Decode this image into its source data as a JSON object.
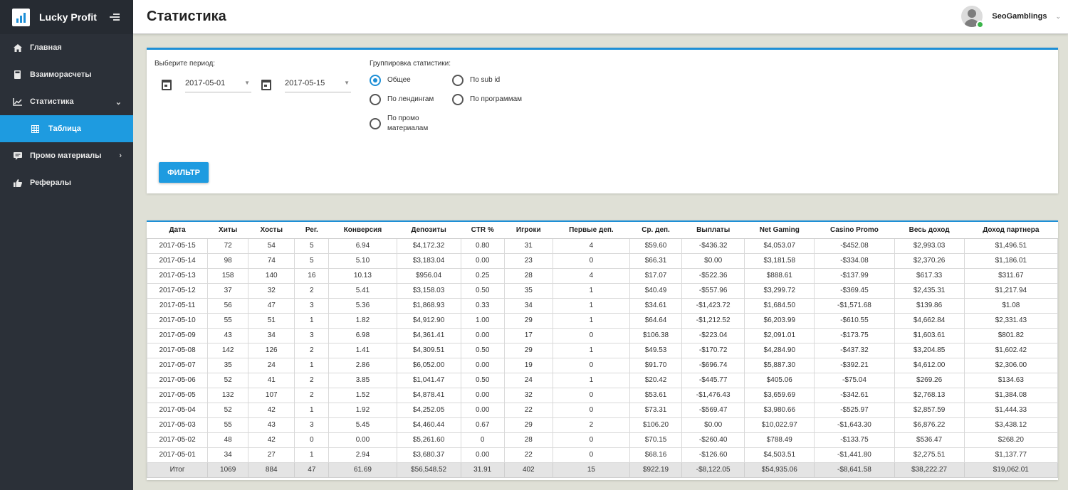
{
  "app": {
    "name": "Lucky Profit"
  },
  "sidebar": {
    "items": [
      {
        "label": "Главная",
        "icon": "home-icon"
      },
      {
        "label": "Взаиморасчеты",
        "icon": "calculator-icon"
      },
      {
        "label": "Статистика",
        "icon": "chart-line-icon"
      },
      {
        "label": "Таблица",
        "icon": "table-icon"
      },
      {
        "label": "Промо материалы",
        "icon": "promo-icon"
      },
      {
        "label": "Рефералы",
        "icon": "thumbs-up-icon"
      }
    ]
  },
  "header": {
    "title": "Статистика",
    "username": "SeoGamblings"
  },
  "filter": {
    "period_label": "Выберите период:",
    "date_from": "2017-05-01",
    "date_to": "2017-05-15",
    "grouping_label": "Группировка статистики:",
    "options": [
      "Общее",
      "По лендингам",
      "По промо материалам",
      "По sub id",
      "По программам"
    ],
    "selected": "Общее",
    "button": "ФИЛЬТР"
  },
  "table": {
    "columns": [
      "Дата",
      "Хиты",
      "Хосты",
      "Рег.",
      "Конверсия",
      "Депозиты",
      "CTR %",
      "Игроки",
      "Первые деп.",
      "Ср. деп.",
      "Выплаты",
      "Net Gaming",
      "Casino Promo",
      "Весь доход",
      "Доход партнера"
    ],
    "rows": [
      [
        "2017-05-15",
        "72",
        "54",
        "5",
        "6.94",
        "$4,172.32",
        "0.80",
        "31",
        "4",
        "$59.60",
        "-$436.32",
        "$4,053.07",
        "-$452.08",
        "$2,993.03",
        "$1,496.51"
      ],
      [
        "2017-05-14",
        "98",
        "74",
        "5",
        "5.10",
        "$3,183.04",
        "0.00",
        "23",
        "0",
        "$66.31",
        "$0.00",
        "$3,181.58",
        "-$334.08",
        "$2,370.26",
        "$1,186.01"
      ],
      [
        "2017-05-13",
        "158",
        "140",
        "16",
        "10.13",
        "$956.04",
        "0.25",
        "28",
        "4",
        "$17.07",
        "-$522.36",
        "$888.61",
        "-$137.99",
        "$617.33",
        "$311.67"
      ],
      [
        "2017-05-12",
        "37",
        "32",
        "2",
        "5.41",
        "$3,158.03",
        "0.50",
        "35",
        "1",
        "$40.49",
        "-$557.96",
        "$3,299.72",
        "-$369.45",
        "$2,435.31",
        "$1,217.94"
      ],
      [
        "2017-05-11",
        "56",
        "47",
        "3",
        "5.36",
        "$1,868.93",
        "0.33",
        "34",
        "1",
        "$34.61",
        "-$1,423.72",
        "$1,684.50",
        "-$1,571.68",
        "$139.86",
        "$1.08"
      ],
      [
        "2017-05-10",
        "55",
        "51",
        "1",
        "1.82",
        "$4,912.90",
        "1.00",
        "29",
        "1",
        "$64.64",
        "-$1,212.52",
        "$6,203.99",
        "-$610.55",
        "$4,662.84",
        "$2,331.43"
      ],
      [
        "2017-05-09",
        "43",
        "34",
        "3",
        "6.98",
        "$4,361.41",
        "0.00",
        "17",
        "0",
        "$106.38",
        "-$223.04",
        "$2,091.01",
        "-$173.75",
        "$1,603.61",
        "$801.82"
      ],
      [
        "2017-05-08",
        "142",
        "126",
        "2",
        "1.41",
        "$4,309.51",
        "0.50",
        "29",
        "1",
        "$49.53",
        "-$170.72",
        "$4,284.90",
        "-$437.32",
        "$3,204.85",
        "$1,602.42"
      ],
      [
        "2017-05-07",
        "35",
        "24",
        "1",
        "2.86",
        "$6,052.00",
        "0.00",
        "19",
        "0",
        "$91.70",
        "-$696.74",
        "$5,887.30",
        "-$392.21",
        "$4,612.00",
        "$2,306.00"
      ],
      [
        "2017-05-06",
        "52",
        "41",
        "2",
        "3.85",
        "$1,041.47",
        "0.50",
        "24",
        "1",
        "$20.42",
        "-$445.77",
        "$405.06",
        "-$75.04",
        "$269.26",
        "$134.63"
      ],
      [
        "2017-05-05",
        "132",
        "107",
        "2",
        "1.52",
        "$4,878.41",
        "0.00",
        "32",
        "0",
        "$53.61",
        "-$1,476.43",
        "$3,659.69",
        "-$342.61",
        "$2,768.13",
        "$1,384.08"
      ],
      [
        "2017-05-04",
        "52",
        "42",
        "1",
        "1.92",
        "$4,252.05",
        "0.00",
        "22",
        "0",
        "$73.31",
        "-$569.47",
        "$3,980.66",
        "-$525.97",
        "$2,857.59",
        "$1,444.33"
      ],
      [
        "2017-05-03",
        "55",
        "43",
        "3",
        "5.45",
        "$4,460.44",
        "0.67",
        "29",
        "2",
        "$106.20",
        "$0.00",
        "$10,022.97",
        "-$1,643.30",
        "$6,876.22",
        "$3,438.12"
      ],
      [
        "2017-05-02",
        "48",
        "42",
        "0",
        "0.00",
        "$5,261.60",
        "0",
        "28",
        "0",
        "$70.15",
        "-$260.40",
        "$788.49",
        "-$133.75",
        "$536.47",
        "$268.20"
      ],
      [
        "2017-05-01",
        "34",
        "27",
        "1",
        "2.94",
        "$3,680.37",
        "0.00",
        "22",
        "0",
        "$68.16",
        "-$126.60",
        "$4,503.51",
        "-$1,441.80",
        "$2,275.51",
        "$1,137.77"
      ]
    ],
    "total": [
      "Итог",
      "1069",
      "884",
      "47",
      "61.69",
      "$56,548.52",
      "31.91",
      "402",
      "15",
      "$922.19",
      "-$8,122.05",
      "$54,935.06",
      "-$8,641.58",
      "$38,222.27",
      "$19,062.01"
    ]
  },
  "colors": {
    "accent": "#1e9be0",
    "sidebar": "#2b3038",
    "success": "#3bb54a"
  }
}
